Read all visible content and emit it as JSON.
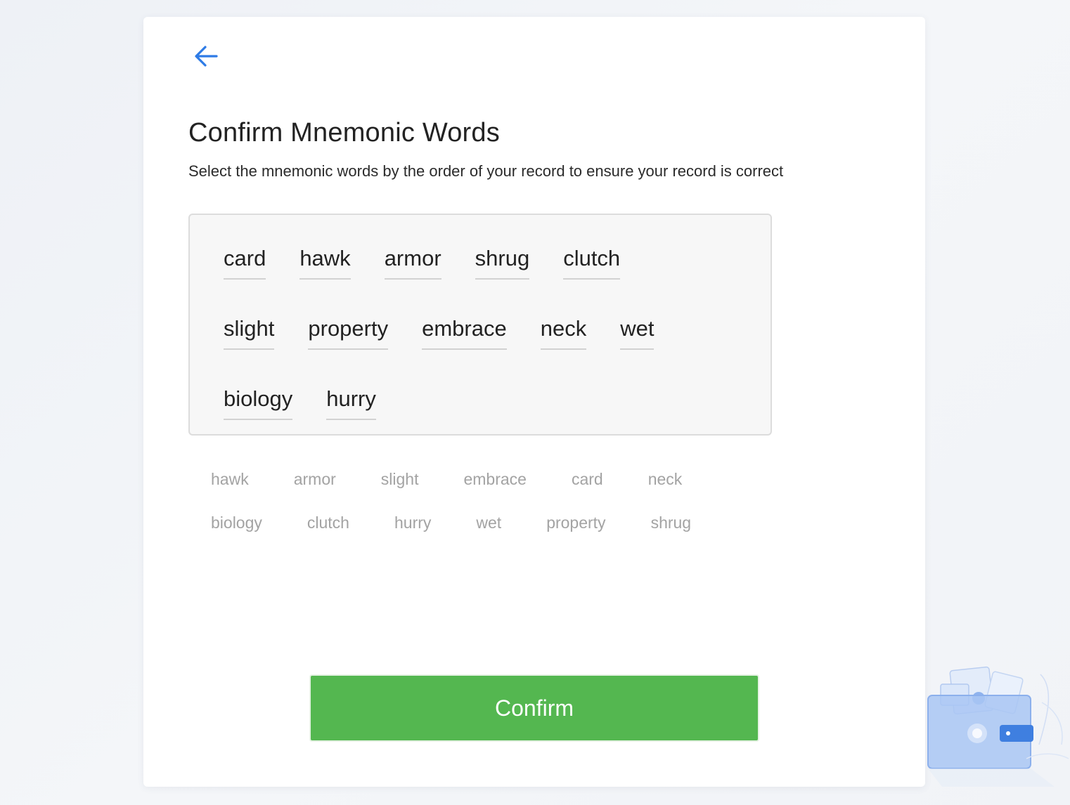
{
  "page": {
    "title": "Confirm Mnemonic Words",
    "subtitle": "Select the mnemonic words by the order of your record to ensure your record is correct",
    "back_icon": "arrow-left-icon",
    "accent_color": "#2e7be6",
    "confirm_color": "#54b750"
  },
  "selected_rows": [
    [
      "card",
      "hawk",
      "armor",
      "shrug",
      "clutch"
    ],
    [
      "slight",
      "property",
      "embrace",
      "neck",
      "wet"
    ],
    [
      "biology",
      "hurry"
    ]
  ],
  "pool_rows": [
    [
      "hawk",
      "armor",
      "slight",
      "embrace",
      "card",
      "neck"
    ],
    [
      "biology",
      "clutch",
      "hurry",
      "wet",
      "property",
      "shrug"
    ]
  ],
  "actions": {
    "confirm_label": "Confirm"
  }
}
